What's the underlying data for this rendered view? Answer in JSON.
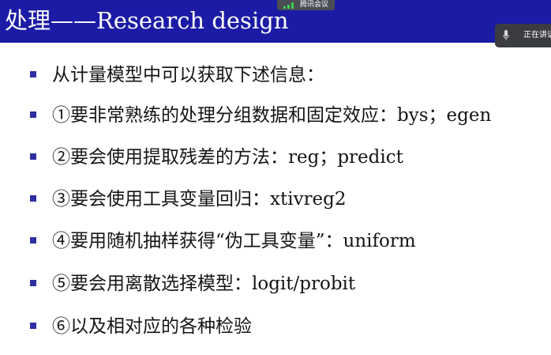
{
  "slide": {
    "title": "处理——Research design",
    "bullet_items": [
      "从计量模型中可以获取下述信息：",
      "①要非常熟练的处理分组数据和固定效应：bys；egen",
      "②要会使用提取残差的方法：reg；predict",
      "③要会使用工具变量回归：xtivreg2",
      "④要用随机抽样获得“伪工具变量”：uniform",
      "⑤要会用离散选择模型：logit/probit",
      "⑥以及相对应的各种检验"
    ]
  },
  "overlay": {
    "meeting_label": "腾讯会议",
    "meeting_icon": "signal-bars-icon",
    "speaking_label": "正在讲话",
    "speaking_icon": "microphone-icon"
  },
  "colors": {
    "title_bar": "#1b1ba6",
    "title_text": "#ffffff",
    "bullet": "#2e2fa0",
    "body_text": "#151515"
  }
}
